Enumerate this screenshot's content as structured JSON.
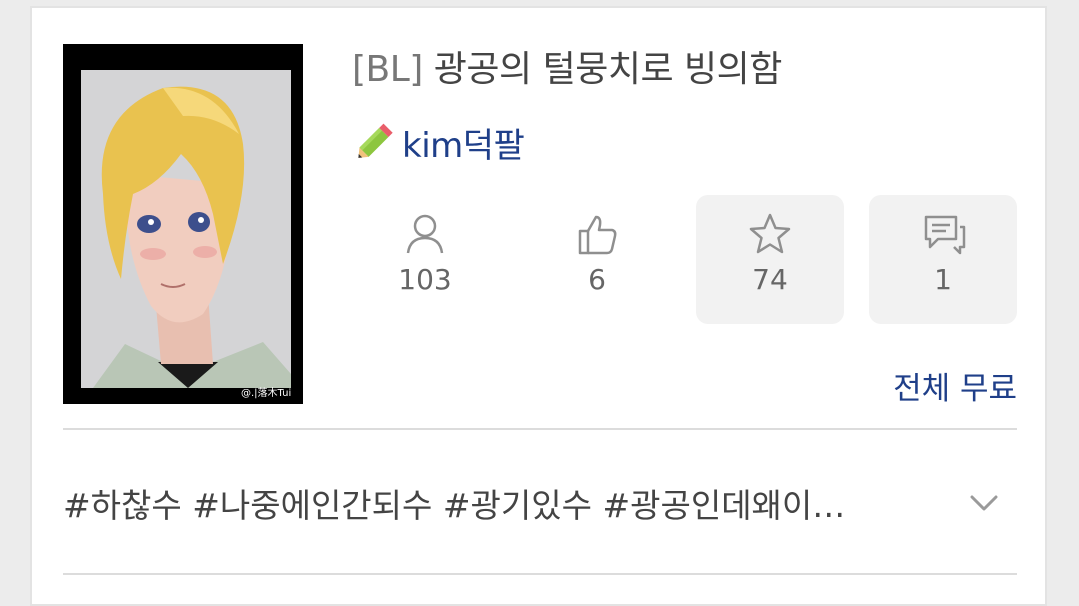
{
  "work": {
    "title_tag": "[BL]",
    "title": "광공의 털뭉치로 빙의함",
    "author": "kim덕팔",
    "price_status": "전체 무료",
    "hashtags": "#하찮수 #나중에인간되수 #광기있수 #광공인데왜이…"
  },
  "stats": {
    "views": "103",
    "likes": "6",
    "favorites": "74",
    "comments": "1"
  },
  "cover": {
    "watermark": "@.|落木Tui"
  },
  "icons": {
    "author": "pencil-icon",
    "views": "person-icon",
    "likes": "thumbs-up-icon",
    "favorites": "star-icon",
    "comments": "comment-icon",
    "expand": "chevron-down-icon"
  },
  "colors": {
    "accent": "#1f3f89",
    "stat_box": "#f2f2f2"
  }
}
